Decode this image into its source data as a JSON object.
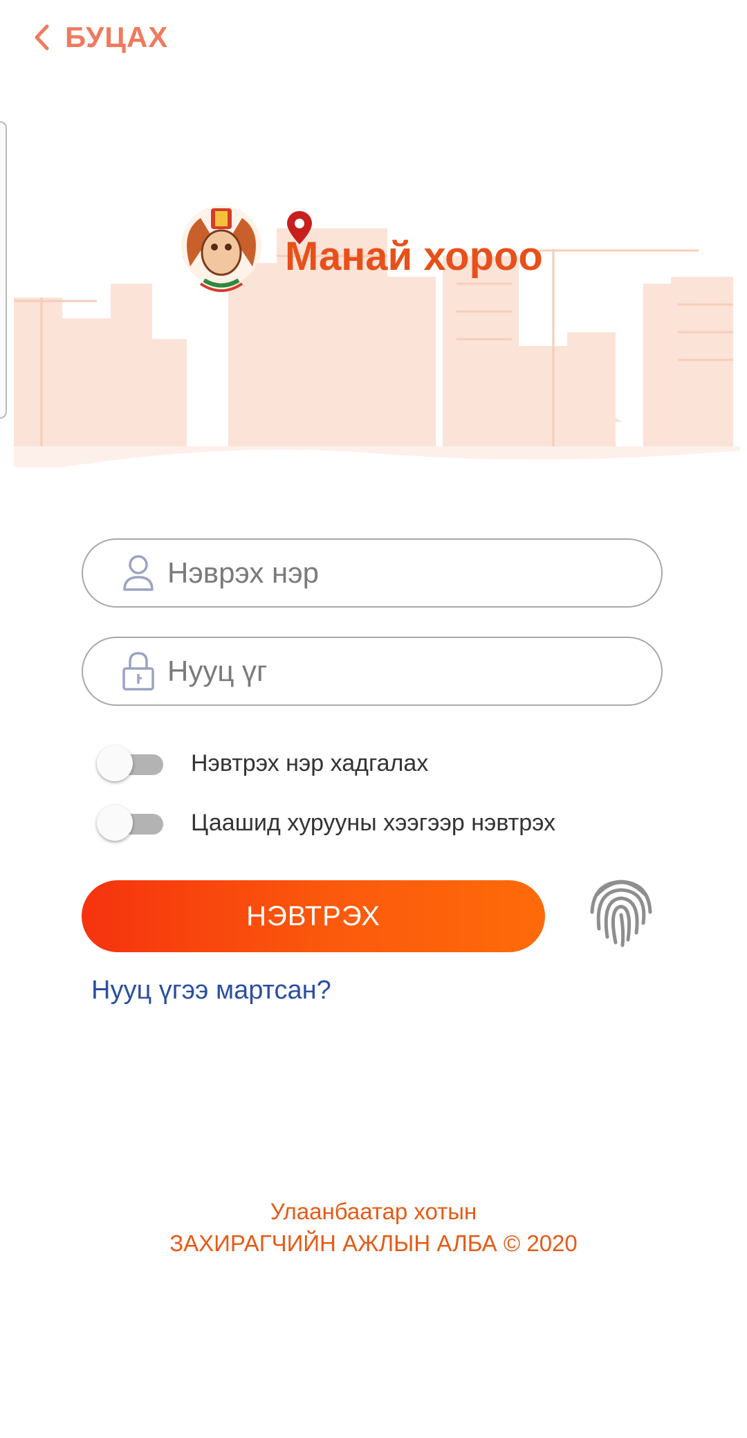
{
  "header": {
    "back_label": "БУЦАХ"
  },
  "brand": {
    "app_name": "Манай хороо"
  },
  "form": {
    "username_placeholder": "Нэврэх нэр",
    "password_placeholder": "Нууц үг",
    "remember_label": "Нэвтрэх нэр хадгалах",
    "remember_on": false,
    "fingerprint_label": "Цаашид хурууны хээгээр нэвтрэх",
    "fingerprint_on": false,
    "login_button": "НЭВТРЭХ",
    "forgot_link": "Нууц үгээ мартсан?"
  },
  "footer": {
    "line1": "Улаанбаатар хотын",
    "line2": "ЗАХИРАГЧИЙН АЖЛЫН АЛБА © 2020"
  },
  "colors": {
    "accent": "#ef7a5f",
    "button_start": "#f6330e",
    "button_end": "#ff6a0a",
    "link": "#2b4fa0",
    "footer": "#e65a17",
    "brand_text": "#e8501a"
  },
  "icons": [
    "chevron-left-icon",
    "emblem-logo",
    "location-pin-icon",
    "user-icon",
    "lock-icon",
    "fingerprint-icon"
  ]
}
